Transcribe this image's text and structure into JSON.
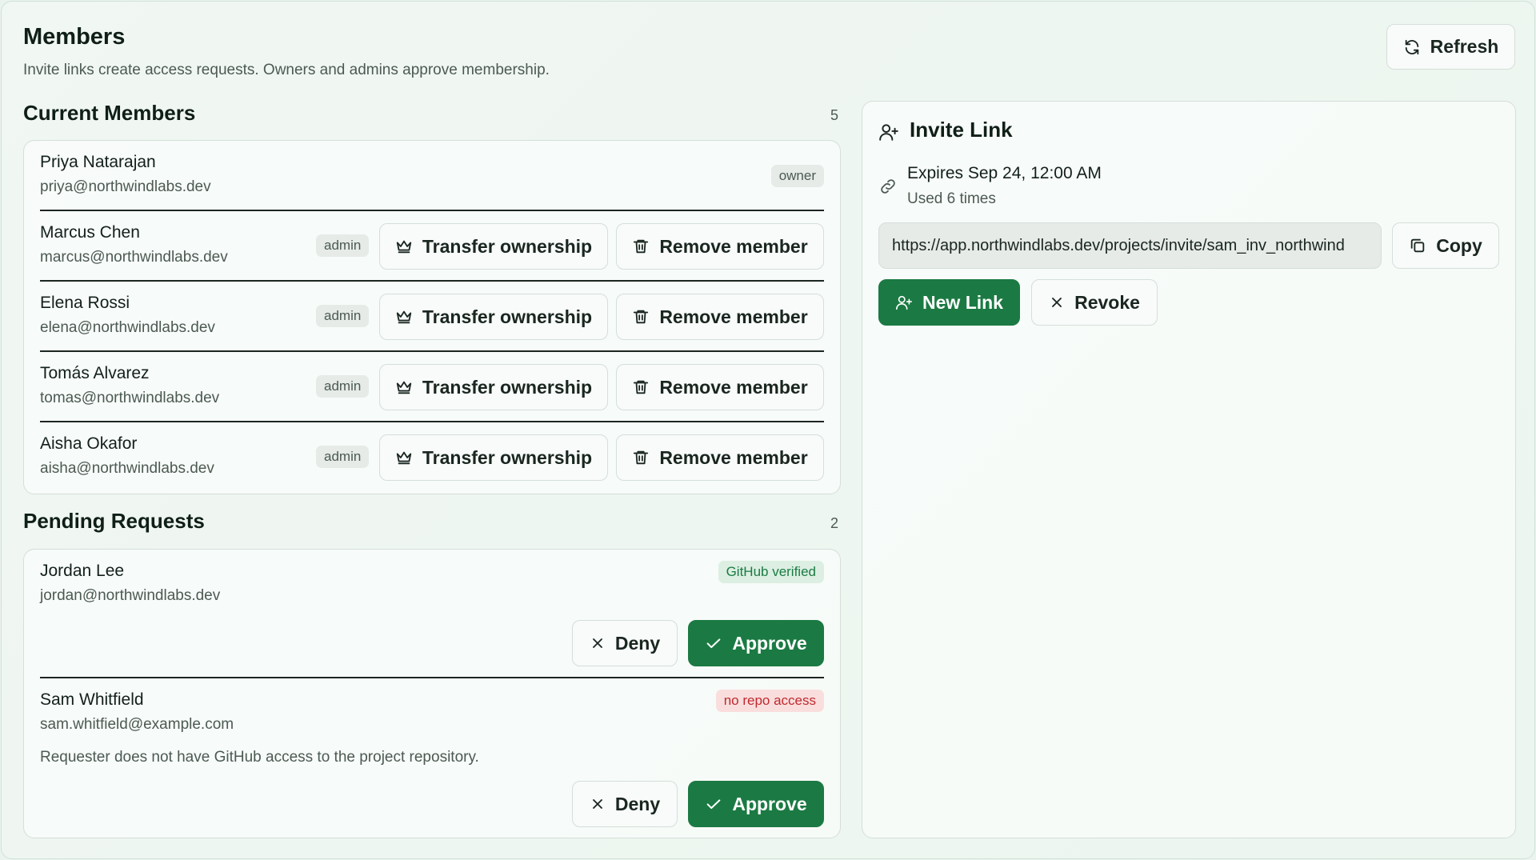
{
  "header": {
    "title": "Members",
    "subtitle": "Invite links create access requests. Owners and admins approve membership.",
    "refresh_label": "Refresh"
  },
  "current_members": {
    "title": "Current Members",
    "count": "5",
    "actions": {
      "transfer_label": "Transfer ownership",
      "remove_label": "Remove member"
    },
    "members": [
      {
        "name": "Priya Natarajan",
        "email": "priya@northwindlabs.dev",
        "role": "owner"
      },
      {
        "name": "Marcus Chen",
        "email": "marcus@northwindlabs.dev",
        "role": "admin"
      },
      {
        "name": "Elena Rossi",
        "email": "elena@northwindlabs.dev",
        "role": "admin"
      },
      {
        "name": "Tomás Alvarez",
        "email": "tomas@northwindlabs.dev",
        "role": "admin"
      },
      {
        "name": "Aisha Okafor",
        "email": "aisha@northwindlabs.dev",
        "role": "admin"
      }
    ]
  },
  "pending_requests": {
    "title": "Pending Requests",
    "count": "2",
    "deny_label": "Deny",
    "approve_label": "Approve",
    "requests": [
      {
        "name": "Jordan Lee",
        "email": "jordan@northwindlabs.dev",
        "status": "GitHub verified",
        "note": ""
      },
      {
        "name": "Sam Whitfield",
        "email": "sam.whitfield@example.com",
        "status": "no repo access",
        "note": "Requester does not have GitHub access to the project repository."
      }
    ]
  },
  "invite_link": {
    "title": "Invite Link",
    "expires": "Expires Sep 24, 12:00 AM",
    "used": "Used 6 times",
    "url": "https://app.northwindlabs.dev/projects/invite/sam_inv_northwind",
    "copy_label": "Copy",
    "new_link_label": "New Link",
    "revoke_label": "Revoke"
  },
  "colors": {
    "accent": "#1b7a43",
    "page_background": "#eef6f1",
    "badge_verified_bg": "#dcefe2",
    "badge_warning_bg": "#f9dedd",
    "badge_warning_text": "#c0292f"
  },
  "icons": {
    "refresh": "refresh-icon",
    "transfer": "crown-icon",
    "remove": "trash-icon",
    "invite": "user-plus-icon",
    "link": "link-icon",
    "copy": "copy-icon",
    "deny": "x-icon",
    "approve": "check-icon"
  }
}
